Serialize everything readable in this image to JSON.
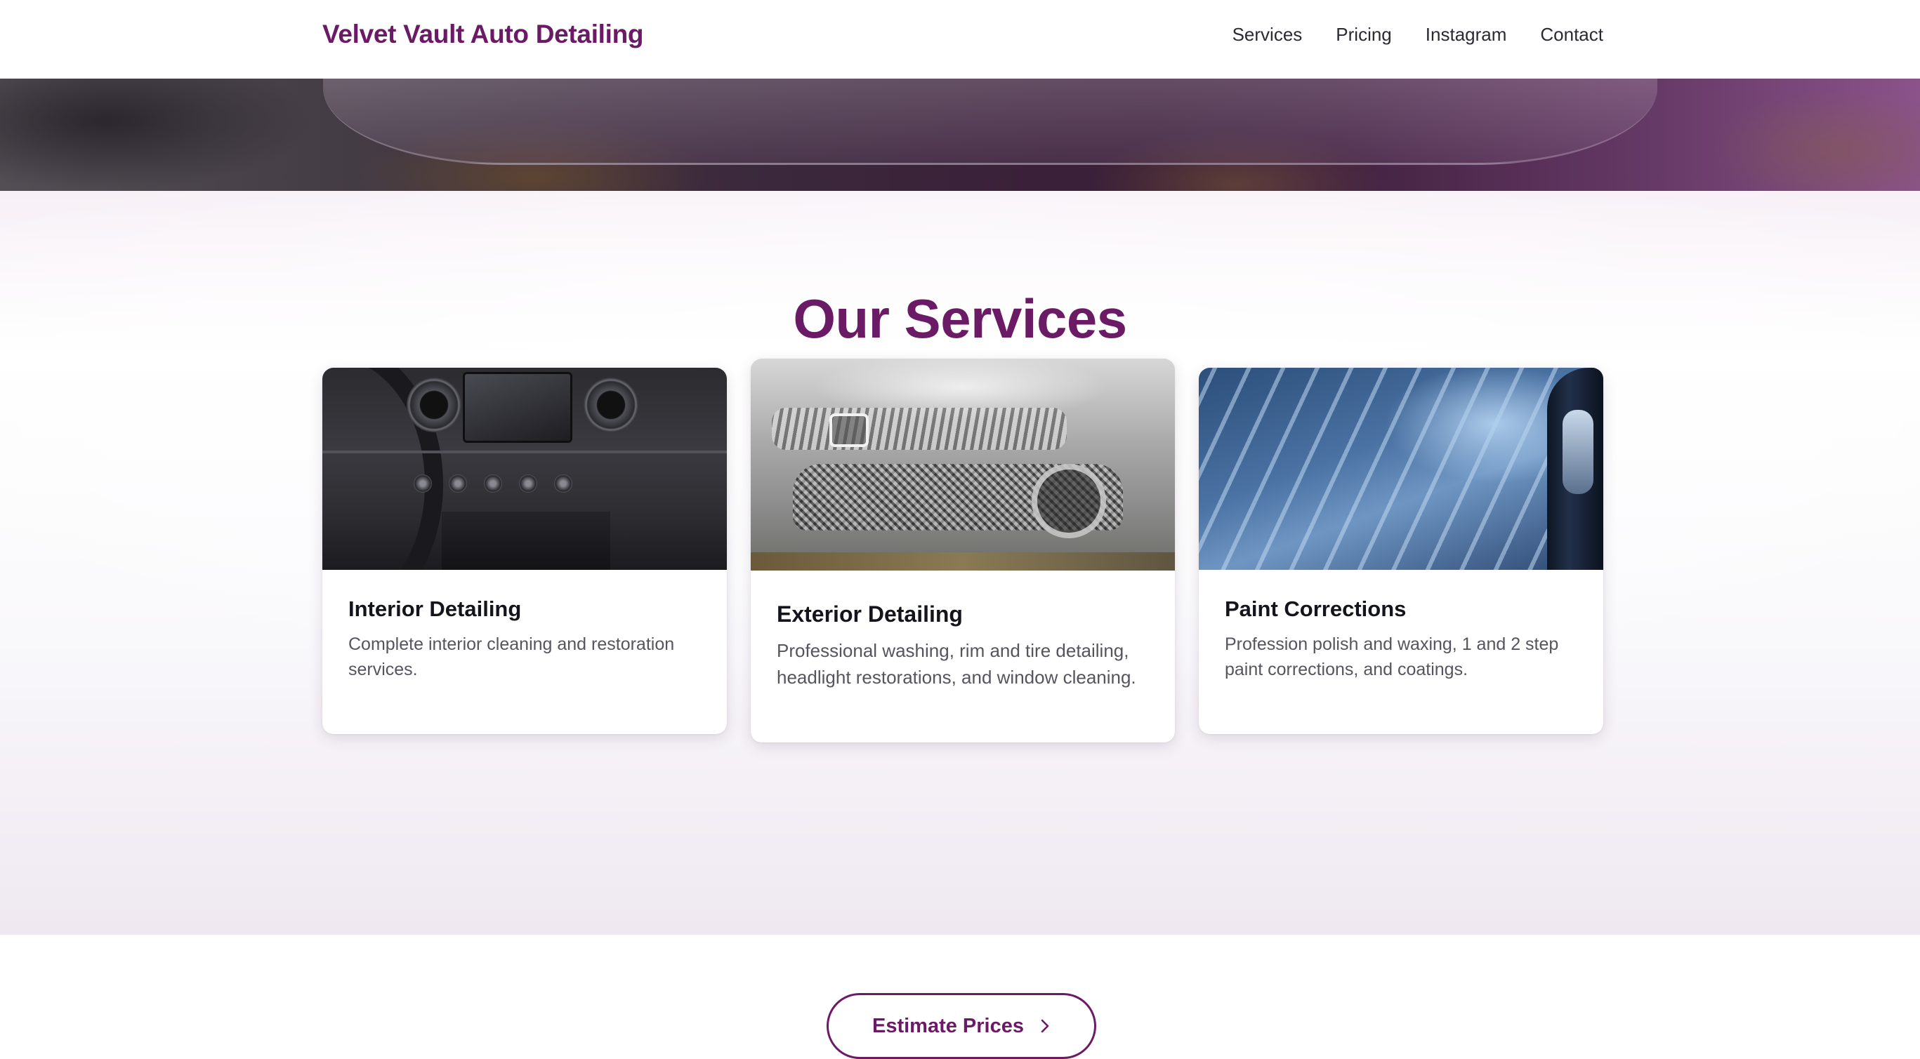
{
  "header": {
    "brand": "Velvet Vault Auto Detailing",
    "nav": [
      {
        "label": "Services"
      },
      {
        "label": "Pricing"
      },
      {
        "label": "Instagram"
      },
      {
        "label": "Contact"
      }
    ]
  },
  "services": {
    "title": "Our Services",
    "cards": [
      {
        "title": "Interior Detailing",
        "description": "Complete interior cleaning and restoration services.",
        "image": "car-dashboard-photo"
      },
      {
        "title": "Exterior Detailing",
        "description": "Professional washing, rim and tire detailing, headlight restorations, and window cleaning.",
        "image": "foamed-car-front-photo"
      },
      {
        "title": "Paint Corrections",
        "description": "Profession polish and waxing, 1 and 2 step paint corrections, and coatings.",
        "image": "car-paint-reflection-photo"
      }
    ],
    "cta_label": "Estimate Prices",
    "cta_icon": "chevron-right-icon"
  },
  "colors": {
    "brand": "#6b1a66",
    "text": "#14141c",
    "muted_text": "#55555f"
  }
}
